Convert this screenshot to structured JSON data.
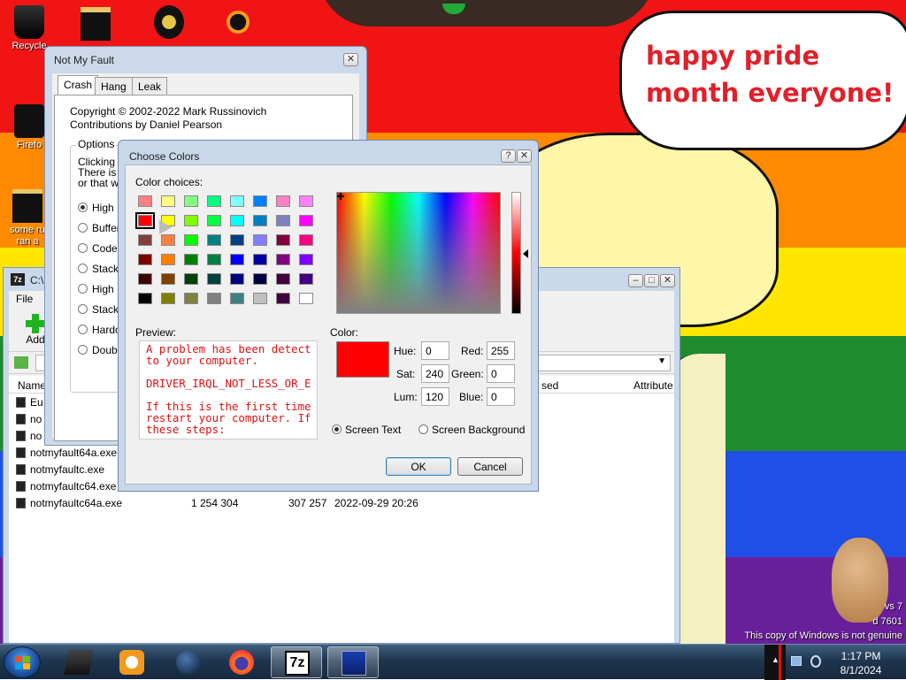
{
  "desktop": {
    "icons": [
      {
        "label": "Recycle"
      },
      {
        "label": "Firefo"
      },
      {
        "label": "some ru\nran a"
      }
    ],
    "bubble_text": "happy pride month everyone!",
    "watermark": {
      "line1": "vs 7",
      "line2": "d 7601",
      "line3": "This copy of Windows is not genuine"
    }
  },
  "zip": {
    "title": "C:\\",
    "menu": [
      "File"
    ],
    "toolbar": {
      "add_label": "Add"
    },
    "columns": {
      "name": "Name",
      "modified": "sed",
      "attributes": "Attribute"
    },
    "files": [
      {
        "name": "Eu",
        "size": "",
        "packed": "",
        "modified": ""
      },
      {
        "name": "no",
        "size": "",
        "packed": "",
        "modified": ""
      },
      {
        "name": "no",
        "size": "",
        "packed": "",
        "modified": ""
      },
      {
        "name": "notmyfault64a.exe",
        "size": "",
        "packed": "",
        "modified": ""
      },
      {
        "name": "notmyfaultc.exe",
        "size": "",
        "packed": "",
        "modified": ""
      },
      {
        "name": "notmyfaultc64.exe",
        "size": "",
        "packed": "",
        "modified": ""
      },
      {
        "name": "notmyfaultc64a.exe",
        "size": "1 254 304",
        "packed": "307 257",
        "modified": "2022-09-29 20:26"
      }
    ]
  },
  "nmf": {
    "title": "Not My Fault",
    "tabs": [
      "Crash",
      "Hang",
      "Leak"
    ],
    "copyright": "Copyright © 2002-2022 Mark Russinovich",
    "contrib": "Contributions by Daniel Pearson",
    "options_label": "Options",
    "desc_lines": [
      "Clicking th",
      "There is a",
      "or that w"
    ],
    "options": [
      "High I",
      "Buffer",
      "Code o",
      "Stack",
      "High I",
      "Stack",
      "Hardc",
      "Double"
    ]
  },
  "cc": {
    "title": "Choose Colors",
    "help": "?",
    "color_choices_label": "Color choices:",
    "preview_label": "Preview:",
    "preview_text": "A problem has been detect\nto your computer.\n\nDRIVER_IRQL_NOT_LESS_OR_E\n\nIf this is the first time\nrestart your computer. If\nthese steps:",
    "color_label": "Color:",
    "fields": {
      "hue_label": "Hue:",
      "hue": "0",
      "sat_label": "Sat:",
      "sat": "240",
      "lum_label": "Lum:",
      "lum": "120",
      "red_label": "Red:",
      "red": "255",
      "green_label": "Green:",
      "green": "0",
      "blue_label": "Blue:",
      "blue": "0"
    },
    "radio_screen_text": "Screen Text",
    "radio_screen_bg": "Screen Background",
    "ok_label": "OK",
    "cancel_label": "Cancel",
    "swatches": [
      [
        "#ff8080",
        "#ffff80",
        "#80ff80",
        "#00ff80",
        "#80ffff",
        "#0080ff",
        "#ff80c0",
        "#ff80ff"
      ],
      [
        "#ff0000",
        "#ffff00",
        "#80ff00",
        "#00ff40",
        "#00ffff",
        "#0080c0",
        "#8080c0",
        "#ff00ff"
      ],
      [
        "#804040",
        "#ff8040",
        "#00ff00",
        "#008080",
        "#004080",
        "#8080ff",
        "#800040",
        "#ff0080"
      ],
      [
        "#800000",
        "#ff8000",
        "#008000",
        "#008040",
        "#0000ff",
        "#0000a0",
        "#800080",
        "#8000ff"
      ],
      [
        "#400000",
        "#804000",
        "#004000",
        "#004040",
        "#000080",
        "#000040",
        "#400040",
        "#400080"
      ],
      [
        "#000000",
        "#808000",
        "#808040",
        "#808080",
        "#408080",
        "#c0c0c0",
        "#400040",
        "#ffffff"
      ]
    ]
  },
  "taskbar": {
    "time": "1:17 PM",
    "date": "8/1/2024"
  }
}
